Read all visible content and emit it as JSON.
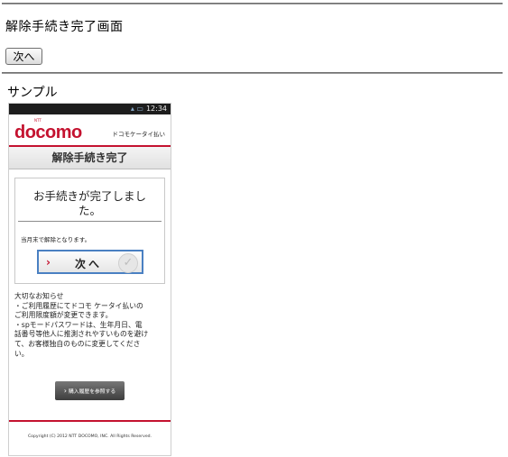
{
  "page": {
    "title": "解除手続き完了画面",
    "next_button": "次へ",
    "sample_label": "サンプル"
  },
  "phone": {
    "status_time": "12:34",
    "logo_sub": "NTT",
    "logo": "docomo",
    "service_name": "ドコモケータイ払い",
    "screen_title": "解除手続き完了",
    "complete_message_line1": "お手続きが完了しまし",
    "complete_message_line2": "た。",
    "note": "当月末で解除となります。",
    "next_button": "次へ",
    "notice_lines": [
      "大切なお知らせ",
      "・ご利用履歴にてドコモ ケータイ払いの",
      "ご利用限度額が変更できます。",
      "・spモードパスワードは、生年月日、電",
      "話番号等他人に推測されやすいものを避け",
      "て、お客様独自のものに変更してくださ",
      "い。"
    ],
    "history_button": "購入履歴を参照する",
    "copyright": "Copyright (C) 2012 NTT DOCOMO, INC. All Rights Reserved."
  },
  "colors": {
    "brand_red": "#c4122f",
    "button_blue_border": "#4a80c2"
  },
  "icons": {
    "chevron": "chevron-right-icon",
    "check": "check-circle-icon"
  }
}
